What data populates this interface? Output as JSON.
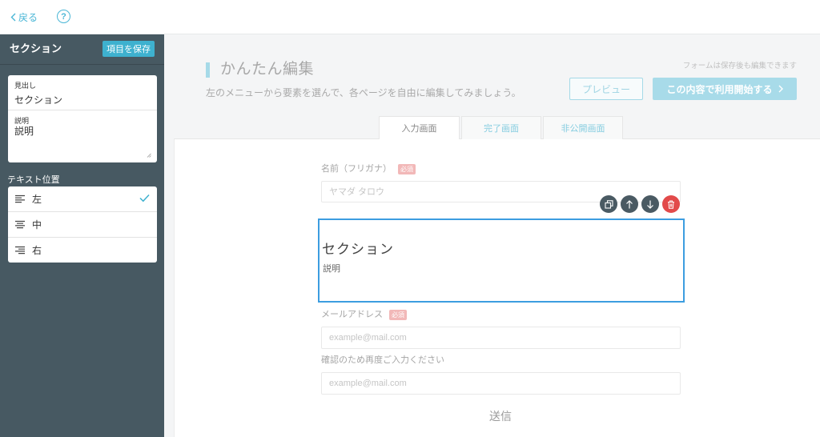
{
  "topbar": {
    "back_label": "戻る",
    "back_icon": "chevron-left-icon",
    "help_icon": "help-circle-icon",
    "help_glyph": "?"
  },
  "sidebar": {
    "title": "セクション",
    "save_button": "項目を保存",
    "heading_field": {
      "label": "見出し",
      "value": "セクション"
    },
    "description_field": {
      "label": "説明",
      "value": "説明"
    },
    "text_position_label": "テキスト位置",
    "text_positions": [
      {
        "label": "左",
        "icon": "align-left-icon",
        "selected": true
      },
      {
        "label": "中",
        "icon": "align-center-icon",
        "selected": false
      },
      {
        "label": "右",
        "icon": "align-right-icon",
        "selected": false
      }
    ]
  },
  "header": {
    "title": "かんたん編集",
    "subtitle": "左のメニューから要素を選んで、各ページを自由に編集してみましょう。",
    "note": "フォームは保存後も編集できます",
    "preview_button": "プレビュー",
    "start_button": "この内容で利用開始する"
  },
  "tabs": [
    {
      "label": "入力画面",
      "active": true
    },
    {
      "label": "完了画面",
      "active": false
    },
    {
      "label": "非公開画面",
      "active": false
    }
  ],
  "form": {
    "fields": [
      {
        "label": "名前（フリガナ）",
        "required_badge": "必須",
        "placeholder": "ヤマダ タロウ"
      },
      {
        "label": "メールアドレス",
        "required_badge": "必須",
        "placeholder": "example@mail.com"
      },
      {
        "label": "確認のため再度ご入力ください",
        "placeholder": "example@mail.com"
      }
    ],
    "selected_section": {
      "title": "セクション",
      "description": "説明"
    },
    "section_tools": [
      "copy-icon",
      "arrow-up-icon",
      "arrow-down-icon",
      "trash-icon"
    ],
    "submit_label": "送信"
  },
  "colors": {
    "accent": "#3eb1cf",
    "sidebar_bg": "#475962",
    "selection_border": "#3c9de0",
    "danger": "#e24a4a",
    "required_badge": "#f2b8b8"
  }
}
